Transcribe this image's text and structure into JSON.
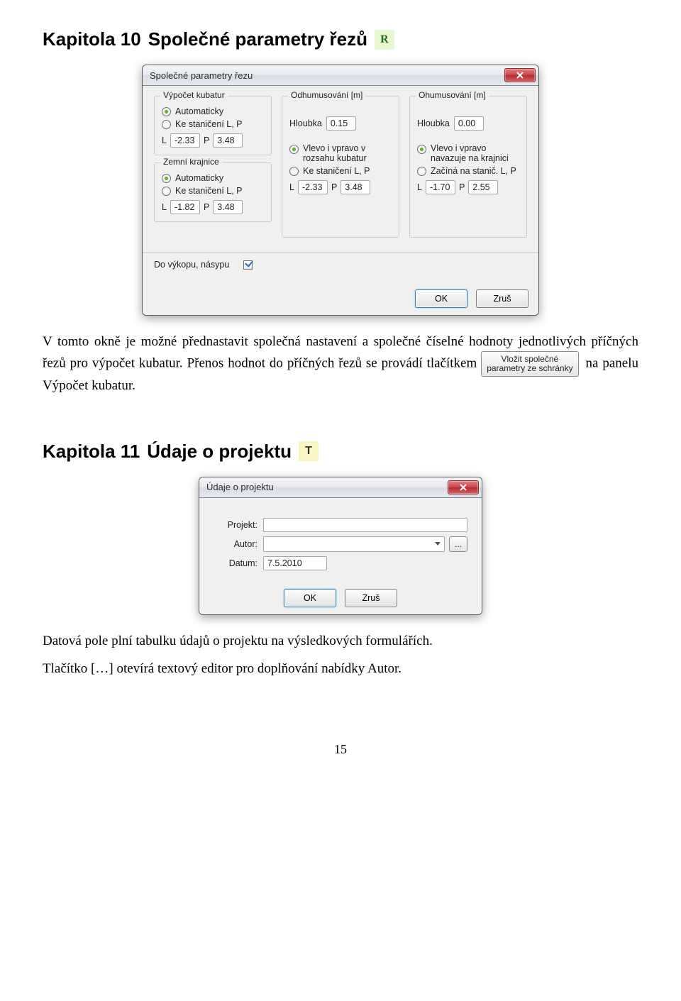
{
  "chapter10": {
    "heading_prefix": "Kapitola 10",
    "heading_title": "Společné parametry řezů",
    "badge": "R"
  },
  "dialog1": {
    "title": "Společné parametry řezu",
    "groups": {
      "vypocet": {
        "title": "Výpočet kubatur",
        "opt_auto": "Automaticky",
        "opt_stanic": "Ke staničení L, P"
      },
      "odhum": {
        "title": "Odhumusování [m]",
        "hloubka_label": "Hloubka",
        "hloubka_val": "0.15",
        "opt_rozsah": "Vlevo i vpravo v rozsahu kubatur",
        "opt_stanic": "Ke staničení L, P"
      },
      "ohum": {
        "title": "Ohumusování [m]",
        "hloubka_label": "Hloubka",
        "hloubka_val": "0.00",
        "opt_krajnice": "Vlevo i vpravo navazuje na krajnici",
        "opt_stanic": "Začíná na stanič. L, P"
      },
      "krajnice": {
        "title": "Zemní krajnice",
        "opt_auto": "Automaticky",
        "opt_stanic": "Ke staničení L, P"
      }
    },
    "lp": {
      "L": "L",
      "P": "P",
      "row1_L": "-2.33",
      "row1_P": "3.48",
      "odhum_L": "-2.33",
      "odhum_P": "3.48",
      "ohum_L": "-1.70",
      "ohum_P": "2.55",
      "kraj_L": "-1.82",
      "kraj_P": "3.48"
    },
    "bottom": {
      "dovykopu": "Do výkopu, násypu"
    },
    "buttons": {
      "ok": "OK",
      "cancel": "Zruš"
    }
  },
  "para1a": "V tomto okně je možné přednastavit společná nastavení a společné číselné hodnoty jednotlivých příčných řezů pro výpočet kubatur. Přenos hodnot do příčných řezů se provádí tlačítkem ",
  "inline_button": "Vložit společné\nparametry ze schránky",
  "para1b": " na panelu Výpočet kubatur.",
  "chapter11": {
    "heading_prefix": "Kapitola 11",
    "heading_title": "Údaje o projektu",
    "badge": "T"
  },
  "dialog2": {
    "title": "Údaje o projektu",
    "labels": {
      "projekt": "Projekt:",
      "autor": "Autor:",
      "datum": "Datum:"
    },
    "values": {
      "projekt": "",
      "autor": "",
      "datum": "7.5.2010"
    },
    "buttons": {
      "ok": "OK",
      "cancel": "Zruš",
      "dots": "..."
    }
  },
  "para2": "Datová pole plní tabulku údajů o projektu na výsledkových formulářích.",
  "para3": "Tlačítko […] otevírá textový editor pro doplňování nabídky Autor.",
  "page_number": "15"
}
